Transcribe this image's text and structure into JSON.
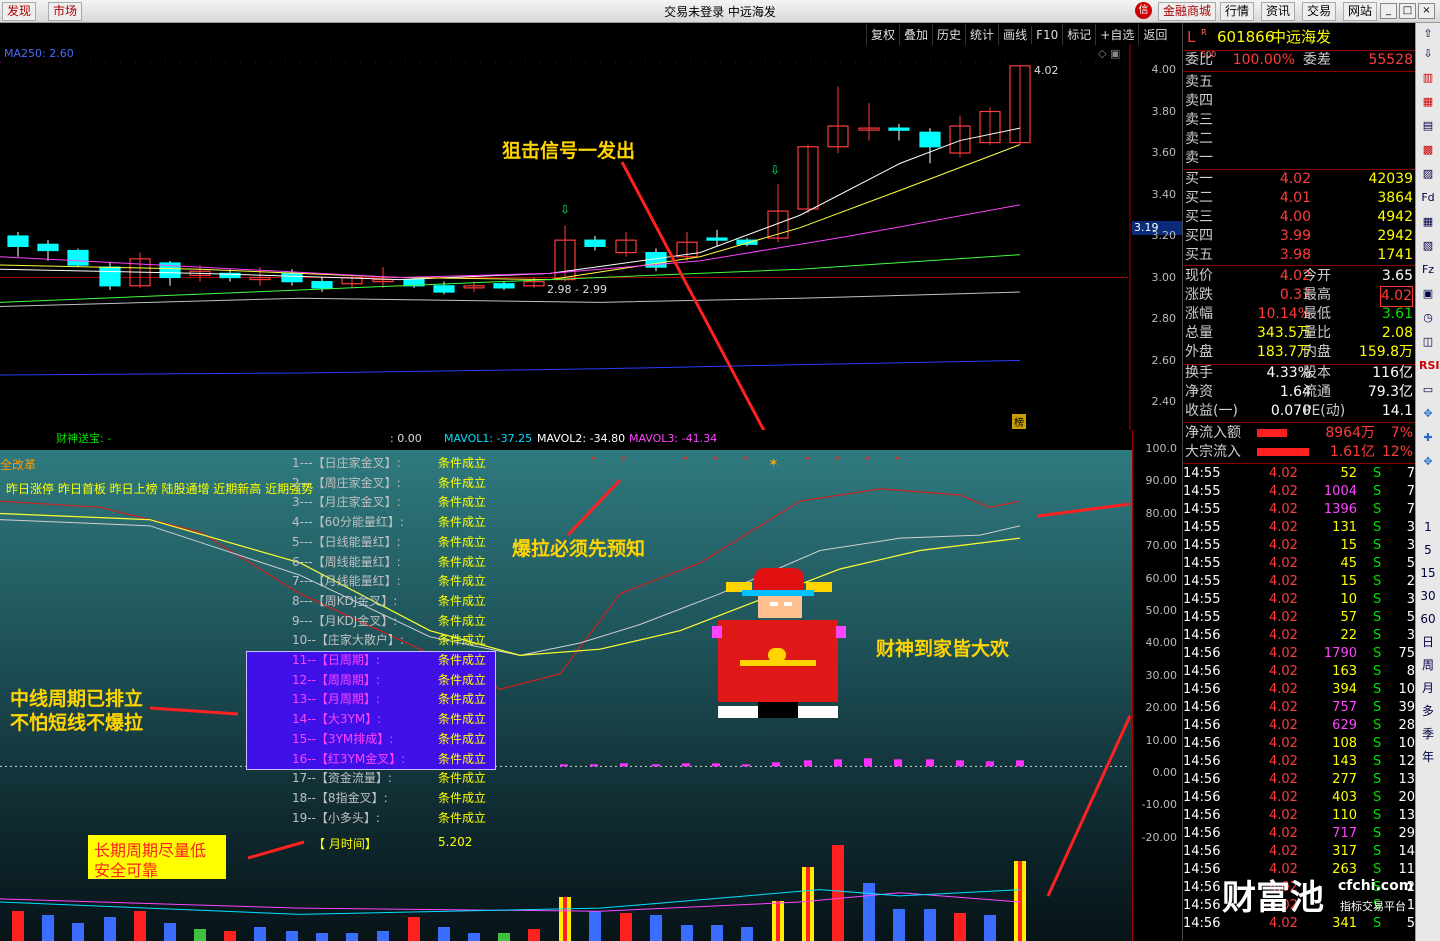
{
  "titlebar": {
    "left_buttons": [
      "发现",
      "市场"
    ],
    "title": "交易未登录  中远海发",
    "right_buttons": [
      "金融商城",
      "行情",
      "资讯",
      "交易",
      "网站"
    ],
    "logo_glyph": "信"
  },
  "chart_toolbar": [
    "复权",
    "叠加",
    "历史",
    "统计",
    "画线",
    "F10",
    "标记",
    "+自选",
    "返回"
  ],
  "upper_chart": {
    "ma_label": "MA250: 2.60",
    "price_ticks": [
      "4.00",
      "3.80",
      "3.60",
      "3.40",
      "3.20",
      "3.00",
      "2.80",
      "2.60",
      "2.40"
    ],
    "current_price_tag": "3.19",
    "high_label": "4.02",
    "range_label": "2.98 - 2.99",
    "corner_badge": "榜",
    "annotation": "狙击信号一发出"
  },
  "indicator_header": {
    "name": "财神送宝: -",
    "val": ": 0.00",
    "mavol1": "MAVOL1: -37.25",
    "mavol2": "MAVOL2: -34.80",
    "mavol3": "MAVOL3: -41.34"
  },
  "lower_chart": {
    "top_left_label": "全改革",
    "tag_line": "昨日涨停 昨日首板 昨日上榜 陆股通增 近期新高 近期强势",
    "axis_ticks": [
      "100.0",
      "90.00",
      "80.00",
      "70.00",
      "60.00",
      "50.00",
      "40.00",
      "30.00",
      "20.00",
      "10.00",
      "0.00",
      "-10.00",
      "-20.00"
    ],
    "conditions": [
      {
        "name": "1---【日庄家金叉】:",
        "value": "条件成立"
      },
      {
        "name": "2---【周庄家金叉】:",
        "value": "条件成立"
      },
      {
        "name": "3---【月庄家金叉】:",
        "value": "条件成立"
      },
      {
        "name": "4---【60分能量红】:",
        "value": "条件成立"
      },
      {
        "name": "5---【日线能量红】:",
        "value": "条件成立"
      },
      {
        "name": "6---【周线能量红】:",
        "value": "条件成立"
      },
      {
        "name": "7---【月线能量红】:",
        "value": "条件成立"
      },
      {
        "name": "8---【周KDJ金叉】:",
        "value": "条件成立"
      },
      {
        "name": "9---【月KDJ金叉】:",
        "value": "条件成立"
      },
      {
        "name": "10--【庄家大散户】:",
        "value": "条件成立"
      },
      {
        "name": "11--【日周期】:",
        "value": "条件成立"
      },
      {
        "name": "12--【周周期】:",
        "value": "条件成立"
      },
      {
        "name": "13--【月周期】:",
        "value": "条件成立"
      },
      {
        "name": "14--【大3YM】:",
        "value": "条件成立"
      },
      {
        "name": "15--【3YM排成】:",
        "value": "条件成立"
      },
      {
        "name": "16--【红3YM金叉】:",
        "value": "条件成立"
      },
      {
        "name": "17--【资金流量】:",
        "value": "条件成立"
      },
      {
        "name": "18--【8指金叉】:",
        "value": "条件成立"
      },
      {
        "name": "19--【小多头】:",
        "value": "条件成立"
      }
    ],
    "month_time_label": "【 月时间】",
    "month_time_value": "5.202",
    "annotation_1": "爆拉必须先预知",
    "annotation_2": "财神到家皆大欢",
    "annotation_3_line1": "中线周期已排立",
    "annotation_3_line2": "不怕短线不爆拉",
    "annotation_4_line1": "长期周期尽量低",
    "annotation_4_line2": "安全可靠"
  },
  "quote_panel": {
    "header_prefix": "L",
    "code": "601866",
    "name": "中远海发",
    "weibi_label": "委比",
    "weibi_value": "100.00%",
    "weicha_label": "委差",
    "weicha_value": "55528",
    "sell_labels": [
      "卖五",
      "卖四",
      "卖三",
      "卖二",
      "卖一"
    ],
    "buy": [
      {
        "label": "买一",
        "price": "4.02",
        "vol": "42039"
      },
      {
        "label": "买二",
        "price": "4.01",
        "vol": "3864"
      },
      {
        "label": "买三",
        "price": "4.00",
        "vol": "4942"
      },
      {
        "label": "买四",
        "price": "3.99",
        "vol": "2942"
      },
      {
        "label": "买五",
        "price": "3.98",
        "vol": "1741"
      }
    ],
    "stats": [
      {
        "l1": "现价",
        "v1": "4.02",
        "l2": "今开",
        "v2": "3.65"
      },
      {
        "l1": "涨跌",
        "v1": "0.37",
        "l2": "最高",
        "v2": "4.02"
      },
      {
        "l1": "涨幅",
        "v1": "10.14%",
        "l2": "最低",
        "v2": "3.61"
      },
      {
        "l1": "总量",
        "v1": "343.5万",
        "l2": "量比",
        "v2": "2.08"
      },
      {
        "l1": "外盘",
        "v1": "183.7万",
        "l2": "内盘",
        "v2": "159.8万"
      }
    ],
    "stats2": [
      {
        "l1": "换手",
        "v1": "4.33%",
        "l2": "股本",
        "v2": "116亿"
      },
      {
        "l1": "净资",
        "v1": "1.64",
        "l2": "流通",
        "v2": "79.3亿"
      },
      {
        "l1": "收益(一)",
        "v1": "0.070",
        "l2": "PE(动)",
        "v2": "14.1"
      }
    ],
    "flow": [
      {
        "label": "净流入额",
        "value": "8964万",
        "pct": "7%"
      },
      {
        "label": "大宗流入",
        "value": "1.61亿",
        "pct": "12%"
      }
    ],
    "ticks": [
      [
        "14:55",
        "4.02",
        "52",
        "S",
        "7"
      ],
      [
        "14:55",
        "4.02",
        "1004",
        "S",
        "7"
      ],
      [
        "14:55",
        "4.02",
        "1396",
        "S",
        "7"
      ],
      [
        "14:55",
        "4.02",
        "131",
        "S",
        "3"
      ],
      [
        "14:55",
        "4.02",
        "15",
        "S",
        "3"
      ],
      [
        "14:55",
        "4.02",
        "45",
        "S",
        "5"
      ],
      [
        "14:55",
        "4.02",
        "15",
        "S",
        "2"
      ],
      [
        "14:55",
        "4.02",
        "10",
        "S",
        "3"
      ],
      [
        "14:55",
        "4.02",
        "57",
        "S",
        "5"
      ],
      [
        "14:56",
        "4.02",
        "22",
        "S",
        "3"
      ],
      [
        "14:56",
        "4.02",
        "1790",
        "S",
        "75"
      ],
      [
        "14:56",
        "4.02",
        "163",
        "S",
        "8"
      ],
      [
        "14:56",
        "4.02",
        "394",
        "S",
        "10"
      ],
      [
        "14:56",
        "4.02",
        "757",
        "S",
        "39"
      ],
      [
        "14:56",
        "4.02",
        "629",
        "S",
        "28"
      ],
      [
        "14:56",
        "4.02",
        "108",
        "S",
        "10"
      ],
      [
        "14:56",
        "4.02",
        "143",
        "S",
        "12"
      ],
      [
        "14:56",
        "4.02",
        "277",
        "S",
        "13"
      ],
      [
        "14:56",
        "4.02",
        "403",
        "S",
        "20"
      ],
      [
        "14:56",
        "4.02",
        "110",
        "S",
        "13"
      ],
      [
        "14:56",
        "4.02",
        "717",
        "S",
        "29"
      ],
      [
        "14:56",
        "4.02",
        "317",
        "S",
        "14"
      ],
      [
        "14:56",
        "4.02",
        "263",
        "S",
        "11"
      ],
      [
        "14:56",
        "4.02",
        "",
        "S",
        "2"
      ],
      [
        "14:56",
        "4.02",
        "",
        "S",
        "1"
      ],
      [
        "14:56",
        "4.02",
        "341",
        "S",
        "5"
      ]
    ]
  },
  "watermark": {
    "brand": "财富池",
    "site": "cfchi.com",
    "sub": "指标交易平台"
  },
  "icon_strip": [
    "1",
    "5",
    "15",
    "30",
    "60",
    "日",
    "周",
    "月",
    "多",
    "季",
    "年"
  ],
  "colors": {
    "up": "#ff3b3b",
    "down": "#00ffff",
    "accent_yellow": "#ffff00"
  }
}
